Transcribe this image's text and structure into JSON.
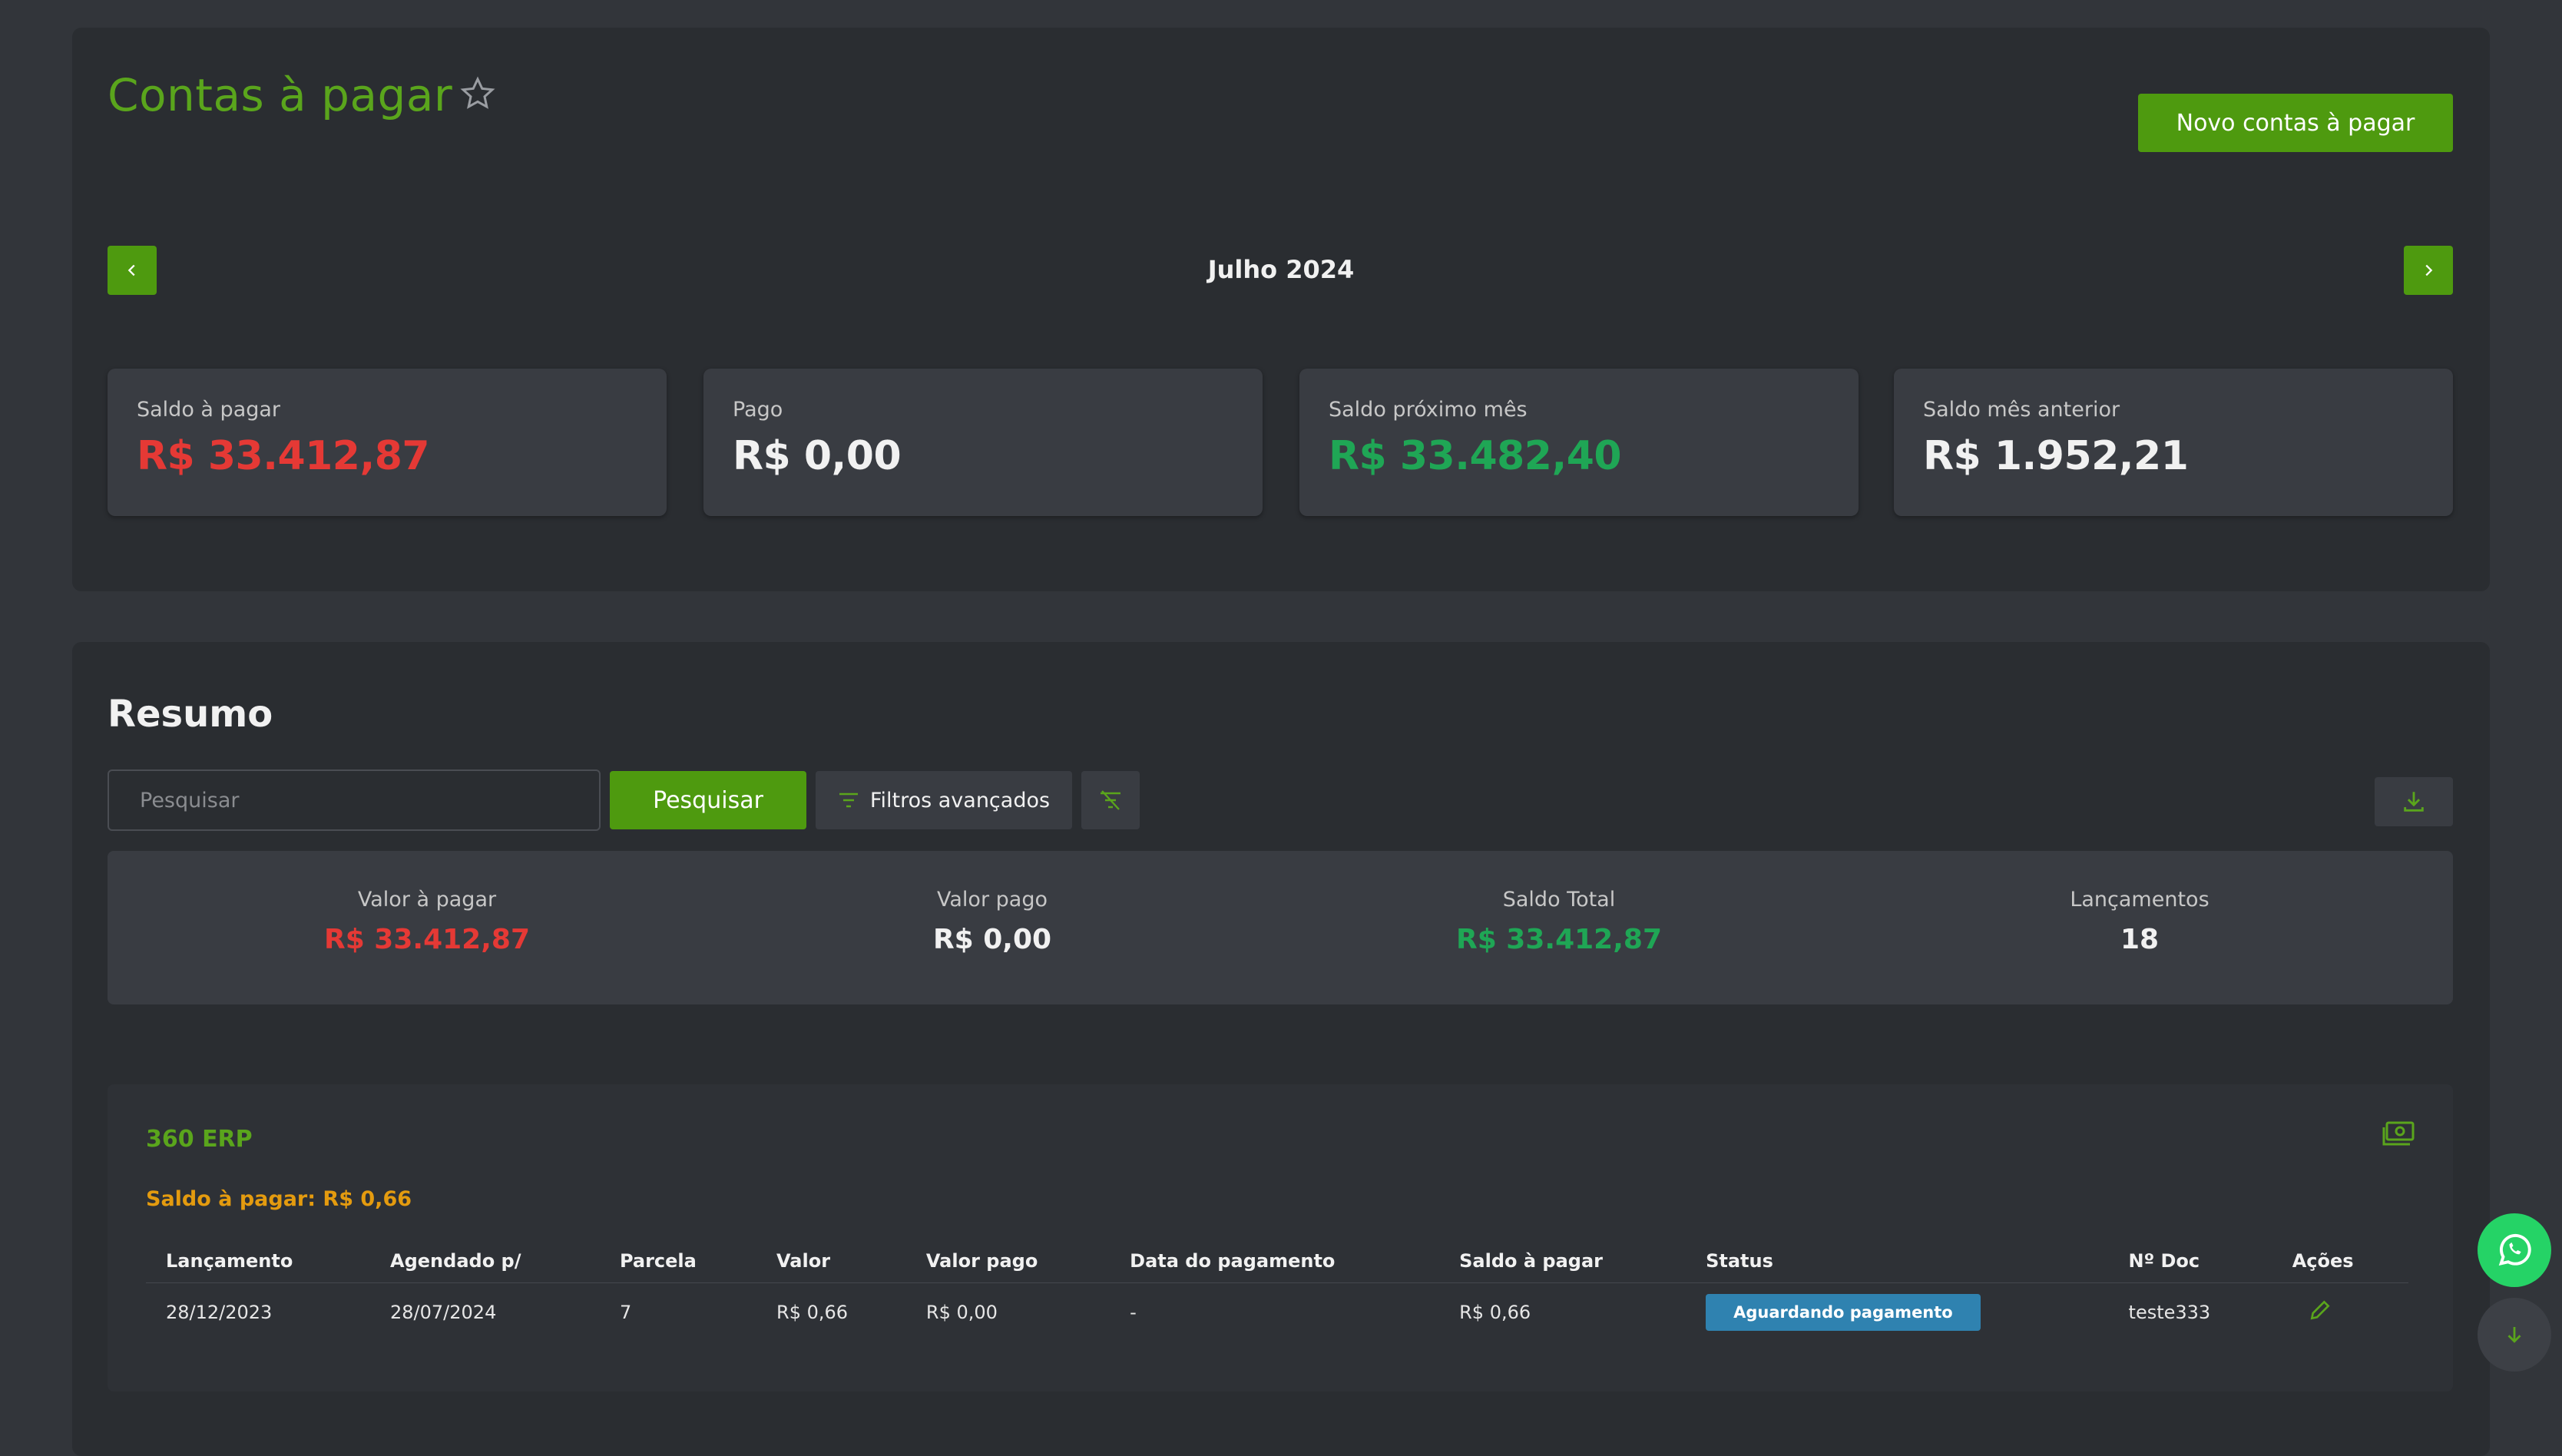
{
  "header": {
    "title": "Contas à pagar",
    "new_button": "Novo contas à pagar"
  },
  "period": {
    "month_label": "Julho 2024"
  },
  "stats": [
    {
      "label": "Saldo à pagar",
      "value": "R$ 33.412,87",
      "color": "#e53935"
    },
    {
      "label": "Pago",
      "value": "R$ 0,00",
      "color": "#f1f1f1"
    },
    {
      "label": "Saldo próximo mês",
      "value": "R$ 33.482,40",
      "color": "#1fa655"
    },
    {
      "label": "Saldo mês anterior",
      "value": "R$ 1.952,21",
      "color": "#f1f1f1"
    }
  ],
  "resumo": {
    "title": "Resumo",
    "search_placeholder": "Pesquisar",
    "search_button": "Pesquisar",
    "filters_button": "Filtros avançados"
  },
  "summary": [
    {
      "label": "Valor à pagar",
      "value": "R$ 33.412,87"
    },
    {
      "label": "Valor pago",
      "value": "R$ 0,00"
    },
    {
      "label": "Saldo Total",
      "value": "R$ 33.412,87"
    },
    {
      "label": "Lançamentos",
      "value": "18"
    }
  ],
  "supplier": {
    "name": "360 ERP",
    "balance": "Saldo à pagar: R$ 0,66",
    "columns": [
      "Lançamento",
      "Agendado p/",
      "Parcela",
      "Valor",
      "Valor pago",
      "Data do pagamento",
      "Saldo à pagar",
      "Status",
      "Nº Doc",
      "Ações"
    ],
    "rows": [
      {
        "lancamento": "28/12/2023",
        "agendado": "28/07/2024",
        "parcela": "7",
        "valor": "R$ 0,66",
        "valor_pago": "R$ 0,00",
        "data_pagamento": "-",
        "saldo": "R$ 0,66",
        "status": "Aguardando pagamento",
        "doc": "teste333"
      }
    ]
  },
  "colors": {
    "accent": "#4e9a0f",
    "status_info": "#2f82b0",
    "whatsapp": "#25d366"
  }
}
